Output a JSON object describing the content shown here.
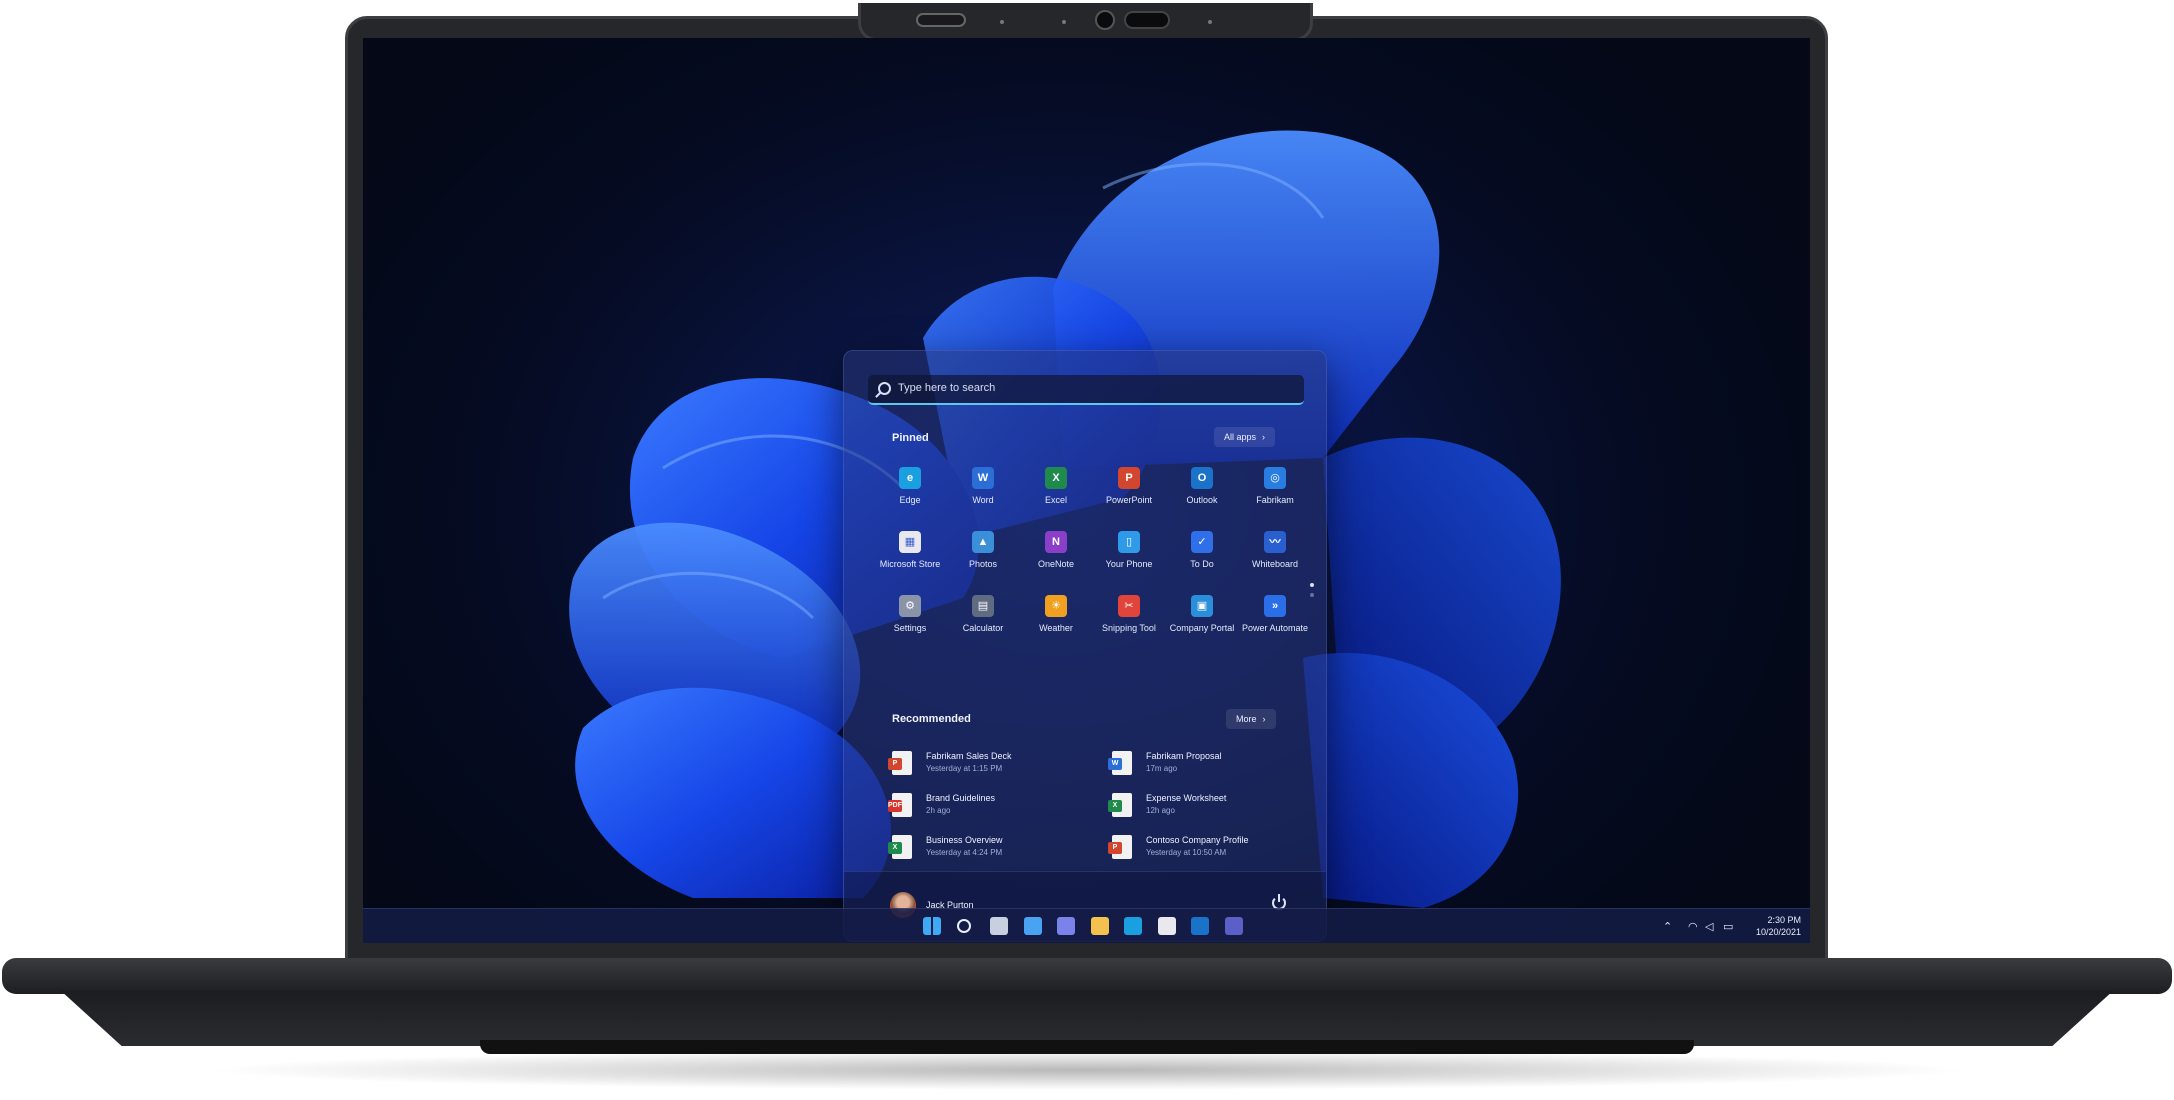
{
  "search": {
    "placeholder": "Type here to search"
  },
  "pinned": {
    "title": "Pinned",
    "all_apps_label": "All apps",
    "apps": [
      {
        "label": "Edge",
        "icon": "edge-icon",
        "color": "#1aa0e0",
        "glyph": "e"
      },
      {
        "label": "Word",
        "icon": "word-icon",
        "color": "#2b6fd6",
        "glyph": "W"
      },
      {
        "label": "Excel",
        "icon": "excel-icon",
        "color": "#1f8a4c",
        "glyph": "X"
      },
      {
        "label": "PowerPoint",
        "icon": "powerpoint-icon",
        "color": "#d2452e",
        "glyph": "P"
      },
      {
        "label": "Outlook",
        "icon": "outlook-icon",
        "color": "#1a73c8",
        "glyph": "O"
      },
      {
        "label": "Fabrikam",
        "icon": "fabrikam-icon",
        "color": "#2a7de0",
        "glyph": "◎"
      },
      {
        "label": "Microsoft Store",
        "icon": "store-icon",
        "color": "#e8e8ee",
        "glyph": "▦"
      },
      {
        "label": "Photos",
        "icon": "photos-icon",
        "color": "#3a8fd8",
        "glyph": "▲"
      },
      {
        "label": "OneNote",
        "icon": "onenote-icon",
        "color": "#8b3fc9",
        "glyph": "N"
      },
      {
        "label": "Your Phone",
        "icon": "phone-icon",
        "color": "#2f9be8",
        "glyph": "▯"
      },
      {
        "label": "To Do",
        "icon": "todo-icon",
        "color": "#2f6fe8",
        "glyph": "✓"
      },
      {
        "label": "Whiteboard",
        "icon": "whiteboard-icon",
        "color": "#2a5fd0",
        "glyph": "〰"
      },
      {
        "label": "Settings",
        "icon": "settings-icon",
        "color": "#8a93a8",
        "glyph": "⚙"
      },
      {
        "label": "Calculator",
        "icon": "calculator-icon",
        "color": "#5f6b80",
        "glyph": "▤"
      },
      {
        "label": "Weather",
        "icon": "weather-icon",
        "color": "#f0a020",
        "glyph": "☀"
      },
      {
        "label": "Snipping Tool",
        "icon": "snipping-tool-icon",
        "color": "#e0443a",
        "glyph": "✂"
      },
      {
        "label": "Company Portal",
        "icon": "company-portal-icon",
        "color": "#2a8fd8",
        "glyph": "▣"
      },
      {
        "label": "Power Automate",
        "icon": "power-automate-icon",
        "color": "#2a6ee8",
        "glyph": "»"
      }
    ]
  },
  "recommended": {
    "title": "Recommended",
    "more_label": "More",
    "items": [
      {
        "name": "Fabrikam Sales Deck",
        "time": "Yesterday at 1:15 PM",
        "icon": "powerpoint-file-icon",
        "color": "#d2452e",
        "tag": "P"
      },
      {
        "name": "Fabrikam Proposal",
        "time": "17m ago",
        "icon": "word-file-icon",
        "color": "#2b6fd6",
        "tag": "W"
      },
      {
        "name": "Brand Guidelines",
        "time": "2h ago",
        "icon": "pdf-file-icon",
        "color": "#d9342b",
        "tag": "PDF"
      },
      {
        "name": "Expense Worksheet",
        "time": "12h ago",
        "icon": "excel-file-icon",
        "color": "#1f8a4c",
        "tag": "X"
      },
      {
        "name": "Business Overview",
        "time": "Yesterday at 4:24 PM",
        "icon": "excel-file-icon",
        "color": "#1f8a4c",
        "tag": "X"
      },
      {
        "name": "Contoso Company Profile",
        "time": "Yesterday at 10:50 AM",
        "icon": "powerpoint-file-icon",
        "color": "#d2452e",
        "tag": "P"
      }
    ]
  },
  "user": {
    "name": "Jack Purton"
  },
  "taskbar": {
    "icons": [
      "start-icon",
      "search-icon",
      "task-view-icon",
      "widgets-icon",
      "teams-chat-icon",
      "file-explorer-icon",
      "edge-icon",
      "store-icon",
      "outlook-icon",
      "teams-icon"
    ],
    "icon_colors": [
      "#3fa9f5",
      "#e9eefc",
      "#c8cfe0",
      "#4aa3f0",
      "#7b83eb",
      "#f2c14e",
      "#1aa0e0",
      "#e8e8ee",
      "#1a73c8",
      "#5b5fc7"
    ],
    "time": "2:30 PM",
    "date": "10/20/2021"
  }
}
